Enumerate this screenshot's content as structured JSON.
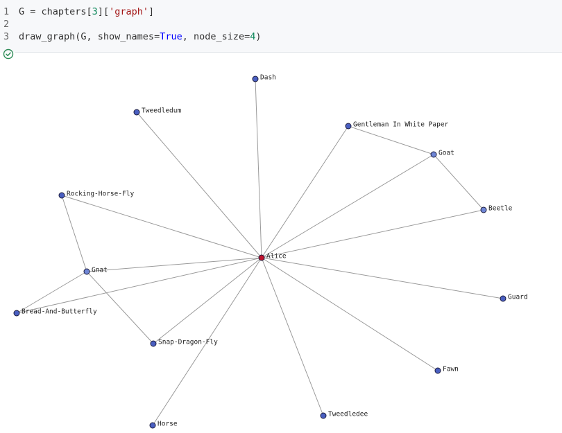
{
  "code_cell": {
    "lines": [
      {
        "no": "1",
        "parts": [
          {
            "t": "G = chapters[",
            "c": "src"
          },
          {
            "t": "3",
            "c": "num"
          },
          {
            "t": "][",
            "c": "src"
          },
          {
            "t": "'graph'",
            "c": "str"
          },
          {
            "t": "]",
            "c": "src"
          }
        ]
      },
      {
        "no": "2",
        "parts": []
      },
      {
        "no": "3",
        "parts": [
          {
            "t": "draw_graph(G, show_names=",
            "c": "src"
          },
          {
            "t": "True",
            "c": "kw"
          },
          {
            "t": ", node_size=",
            "c": "src"
          },
          {
            "t": "4",
            "c": "num"
          },
          {
            "t": ")",
            "c": "src"
          }
        ]
      }
    ],
    "status_icon": "check-circle-icon",
    "status_color": "#2e8b57"
  },
  "graph": {
    "colors": {
      "node_fill": "#4a5fc1",
      "node_fill_light": "#6f86d6",
      "center_fill": "#c0112b",
      "node_stroke": "#1b1b3a",
      "edge": "#9a9a9a"
    },
    "nodes": [
      {
        "id": "Alice",
        "label": "Alice",
        "center": true
      },
      {
        "id": "Dash",
        "label": "Dash"
      },
      {
        "id": "Tweedledum",
        "label": "Tweedledum"
      },
      {
        "id": "Gentleman In White Paper",
        "label": "Gentleman In White Paper"
      },
      {
        "id": "Goat",
        "label": "Goat",
        "light": true
      },
      {
        "id": "Rocking-Horse-Fly",
        "label": "Rocking-Horse-Fly"
      },
      {
        "id": "Beetle",
        "label": "Beetle",
        "light": true
      },
      {
        "id": "Gnat",
        "label": "Gnat",
        "light": true
      },
      {
        "id": "Guard",
        "label": "Guard"
      },
      {
        "id": "Bread-And-Butterfly",
        "label": "Bread-And-Butterfly"
      },
      {
        "id": "Snap-Dragon-Fly",
        "label": "Snap-Dragon-Fly"
      },
      {
        "id": "Fawn",
        "label": "Fawn"
      },
      {
        "id": "Tweedledee",
        "label": "Tweedledee"
      },
      {
        "id": "Horse",
        "label": "Horse"
      }
    ],
    "edges": [
      [
        "Alice",
        "Dash"
      ],
      [
        "Alice",
        "Tweedledum"
      ],
      [
        "Alice",
        "Gentleman In White Paper"
      ],
      [
        "Alice",
        "Goat"
      ],
      [
        "Alice",
        "Rocking-Horse-Fly"
      ],
      [
        "Alice",
        "Beetle"
      ],
      [
        "Alice",
        "Gnat"
      ],
      [
        "Alice",
        "Guard"
      ],
      [
        "Alice",
        "Bread-And-Butterfly"
      ],
      [
        "Alice",
        "Snap-Dragon-Fly"
      ],
      [
        "Alice",
        "Fawn"
      ],
      [
        "Alice",
        "Tweedledee"
      ],
      [
        "Alice",
        "Horse"
      ],
      [
        "Gentleman In White Paper",
        "Goat"
      ],
      [
        "Goat",
        "Beetle"
      ],
      [
        "Rocking-Horse-Fly",
        "Gnat"
      ],
      [
        "Gnat",
        "Bread-And-Butterfly"
      ],
      [
        "Gnat",
        "Snap-Dragon-Fly"
      ]
    ]
  }
}
